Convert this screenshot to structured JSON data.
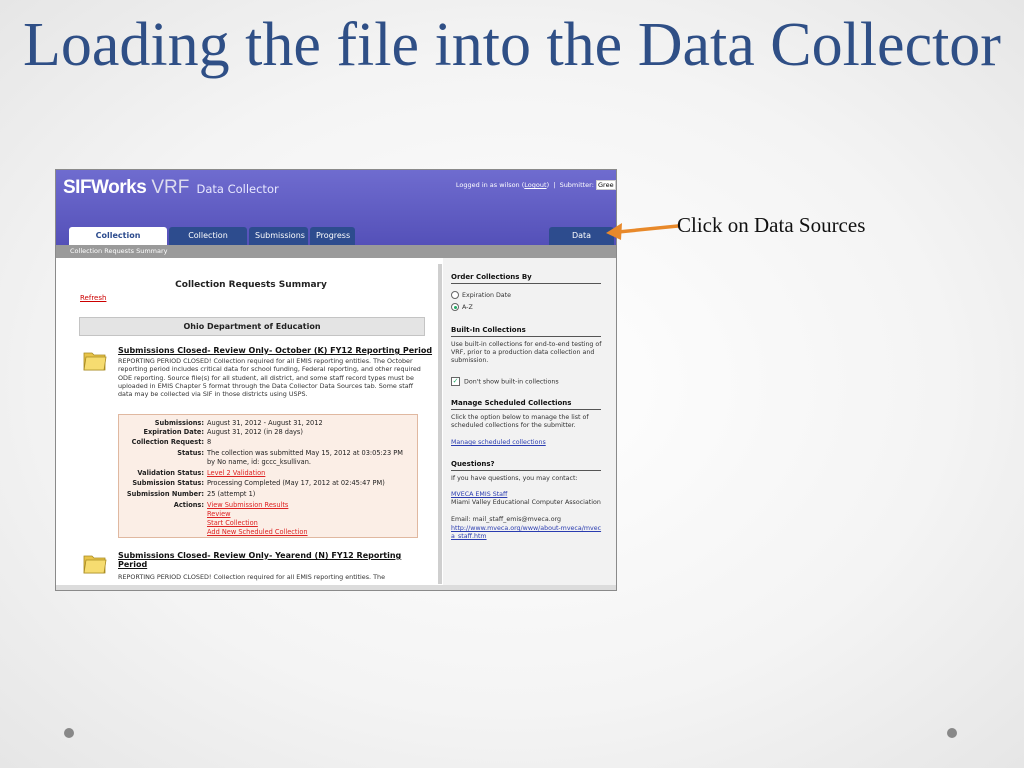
{
  "slide": {
    "title": "Loading the file into the Data Collector",
    "callout": "Click on Data Sources"
  },
  "app": {
    "brand_sif": "SIFWorks",
    "brand_vrf": "VRF",
    "brand_dc": "Data Collector",
    "login_prefix": "Logged in as",
    "login_user": "wilson",
    "logout": "Logout",
    "submitter_label": "Submitter:",
    "submitter_value": "Gree",
    "tabs": [
      "Collection Requests",
      "Collection Status",
      "Submissions",
      "Progress"
    ],
    "data_sources_tab": "Data Sources",
    "subbar": "Collection Requests Summary"
  },
  "main": {
    "title": "Collection Requests Summary",
    "refresh": "Refresh",
    "org": "Ohio Department of Education",
    "requests": [
      {
        "title": "Submissions Closed- Review Only- October (K) FY12 Reporting Period",
        "description": "REPORTING PERIOD CLOSED! Collection required for all EMIS reporting entities. The October reporting period includes critical data for school funding, Federal reporting, and other required ODE reporting. Source file(s) for all student, all district, and some staff record types must be uploaded in EMIS Chapter 5 format through the Data Collector Data Sources tab. Some staff data may be collected via SIF in those districts using USPS."
      },
      {
        "title": "Submissions Closed- Review Only- Yearend (N) FY12 Reporting Period",
        "description": "REPORTING PERIOD CLOSED! Collection required for all EMIS reporting entities. The"
      }
    ],
    "details": {
      "submissions_label": "Submissions:",
      "submissions": "August 31, 2012 - August 31, 2012",
      "expiration_label": "Expiration Date:",
      "expiration": "August 31, 2012 (in 28 days)",
      "collection_request_label": "Collection Request:",
      "collection_request": "8",
      "status_label": "Status:",
      "status_line1": "The collection was submitted May 15, 2012 at 03:05:23 PM",
      "status_line2": "by No name, id: gccc_ksullivan.",
      "validation_label": "Validation Status:",
      "validation": "Level 2 Validation",
      "submission_status_label": "Submission Status:",
      "submission_status": "Processing Completed (May 17, 2012 at 02:45:47 PM)",
      "submission_number_label": "Submission Number:",
      "submission_number": "25 (attempt 1)",
      "actions_label": "Actions:",
      "actions": [
        "View Submission Results",
        "Review",
        "Start Collection",
        "Add New Scheduled Collection"
      ]
    }
  },
  "sidebar": {
    "order_title": "Order Collections By",
    "order_options": [
      "Expiration Date",
      "A-Z"
    ],
    "order_selected": "A-Z",
    "builtin_title": "Built-In Collections",
    "builtin_text": "Use built-in collections for end-to-end testing of VRF, prior to a production data collection and submission.",
    "builtin_checkbox": "Don't show built-in collections",
    "scheduled_title": "Manage Scheduled Collections",
    "scheduled_text": "Click the option below to manage the list of scheduled collections for the submitter.",
    "scheduled_link": "Manage scheduled collections",
    "questions_title": "Questions?",
    "questions_text": "If you have questions, you may contact:",
    "contact_link": "MVECA EMIS Staff",
    "contact_org": "Miami Valley Educational Computer Association",
    "contact_email": "Email: mail_staff_emis@mveca.org",
    "contact_url": "http://www.mveca.org/www/about-mveca/mveca_staff.htm"
  },
  "colors": {
    "title_blue": "#2f4f86",
    "header_purple": "#5f5cc4",
    "tab_navy": "#2d4c8e",
    "arrow_orange": "#e8892a"
  }
}
